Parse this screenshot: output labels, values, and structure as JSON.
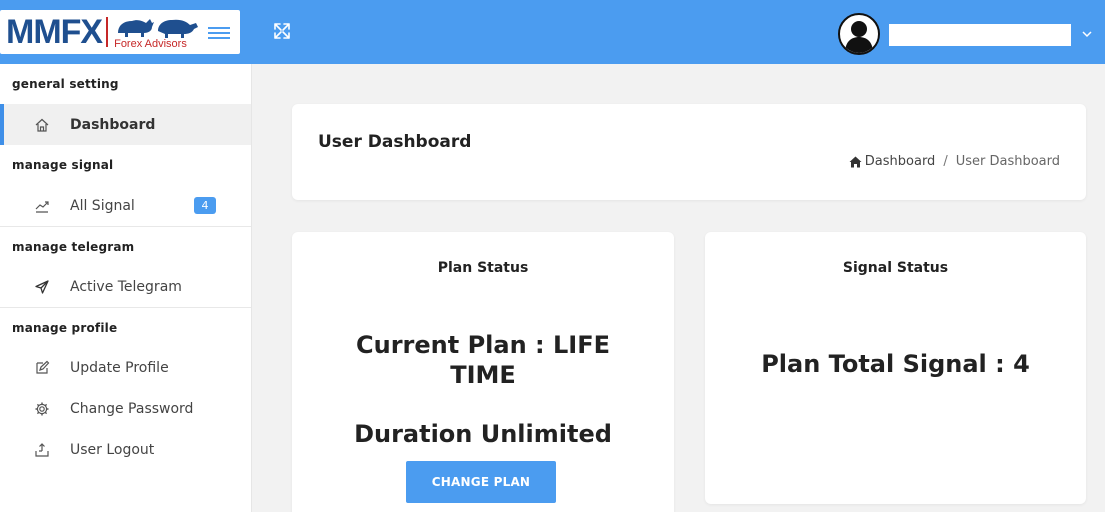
{
  "topbar": {
    "logo_text": "MMFX",
    "logo_sub": "Forex Advisors",
    "username": "",
    "colors": {
      "bar": "#4b9cf0",
      "accent": "#3f8fe8",
      "logo_red": "#c62828"
    }
  },
  "sidebar": {
    "sections": [
      {
        "title": "general setting",
        "items": [
          {
            "label": "Dashboard",
            "icon": "home-icon",
            "active": true
          }
        ]
      },
      {
        "title": "manage signal",
        "items": [
          {
            "label": "All Signal",
            "icon": "trend-icon",
            "badge": "4"
          }
        ]
      },
      {
        "title": "manage telegram",
        "items": [
          {
            "label": "Active Telegram",
            "icon": "paper-plane-icon"
          }
        ]
      },
      {
        "title": "manage profile",
        "items": [
          {
            "label": "Update Profile",
            "icon": "edit-icon"
          },
          {
            "label": "Change Password",
            "icon": "gear-icon"
          },
          {
            "label": "User Logout",
            "icon": "logout-icon"
          }
        ]
      }
    ]
  },
  "page": {
    "title": "User Dashboard",
    "breadcrumb": {
      "home": "Dashboard",
      "separator": "/",
      "current": "User Dashboard"
    }
  },
  "plan_card": {
    "title": "Plan Status",
    "current_plan": "Current Plan : LIFE TIME",
    "duration": "Duration Unlimited",
    "button": "CHANGE PLAN"
  },
  "signal_card": {
    "title": "Signal Status",
    "total": "Plan Total Signal : 4"
  }
}
